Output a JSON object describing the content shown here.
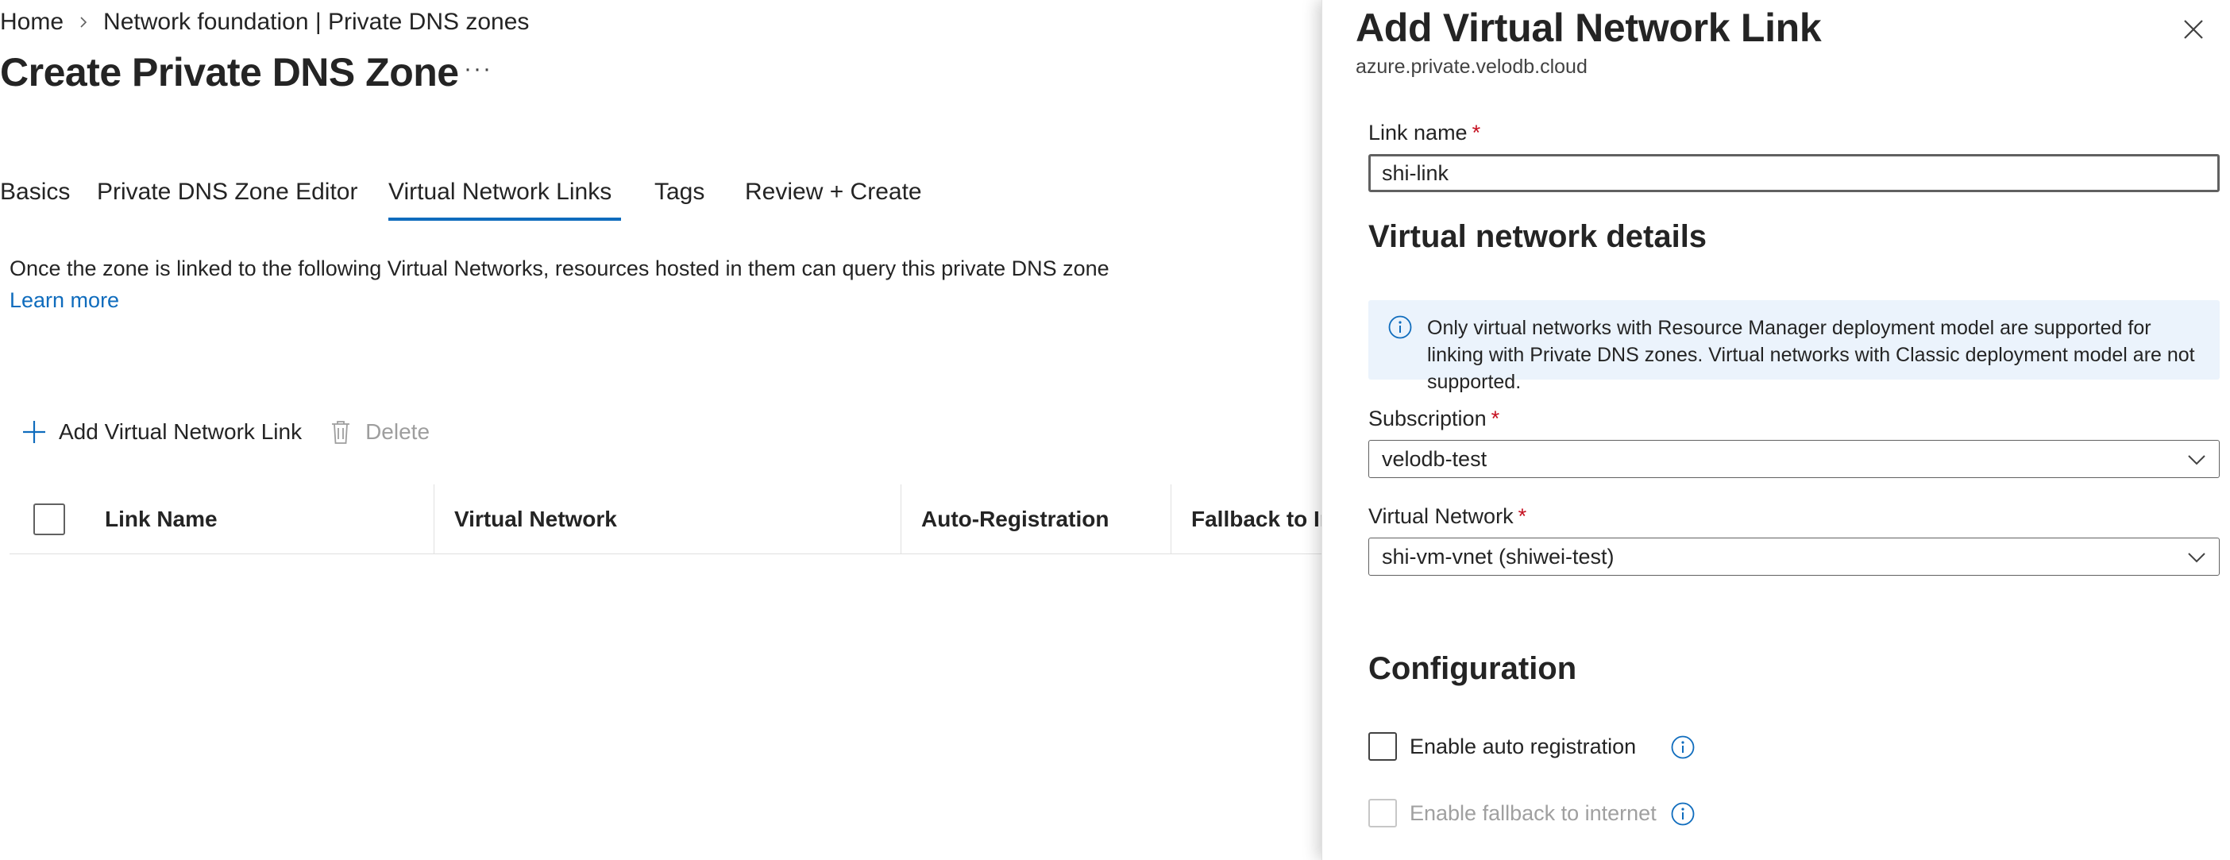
{
  "breadcrumb": {
    "items": [
      "Home",
      "Network foundation | Private DNS zones"
    ]
  },
  "page": {
    "title": "Create Private DNS Zone",
    "more": "···"
  },
  "tabs": [
    {
      "label": "Basics",
      "active": false
    },
    {
      "label": "Private DNS Zone Editor",
      "active": false
    },
    {
      "label": "Virtual Network Links",
      "active": true
    },
    {
      "label": "Tags",
      "active": false
    },
    {
      "label": "Review + Create",
      "active": false
    }
  ],
  "intro": {
    "text": "Once the zone is linked to the following Virtual Networks, resources hosted in them can query this private DNS zone",
    "link": "Learn more"
  },
  "toolbar": {
    "add_label": "Add Virtual Network Link",
    "delete_label": "Delete"
  },
  "grid": {
    "columns": [
      "Link Name",
      "Virtual Network",
      "Auto-Registration",
      "Fallback to Internet"
    ]
  },
  "blade": {
    "title": "Add Virtual Network Link",
    "subtitle": "azure.private.velodb.cloud",
    "link_name_label": "Link name",
    "link_name_value": "shi-link",
    "required_mark": "*",
    "vnet_details_heading": "Virtual network details",
    "info_text": "Only virtual networks with Resource Manager deployment model are supported for linking with Private DNS zones. Virtual networks with Classic deployment model are not supported.",
    "subscription_label": "Subscription",
    "subscription_value": "velodb-test",
    "vnet_label": "Virtual Network",
    "vnet_value": "shi-vm-vnet (shiwei-test)",
    "config_heading": "Configuration",
    "auto_registration_label": "Enable auto registration",
    "fallback_label": "Enable fallback to internet"
  },
  "colors": {
    "accent": "#0f6cbd",
    "info_bg": "#ebf3fc",
    "required": "#c50f1f"
  },
  "icons": [
    "chevron-right-icon",
    "add-icon",
    "trash-icon",
    "close-icon",
    "info-icon",
    "chevron-down-icon"
  ]
}
